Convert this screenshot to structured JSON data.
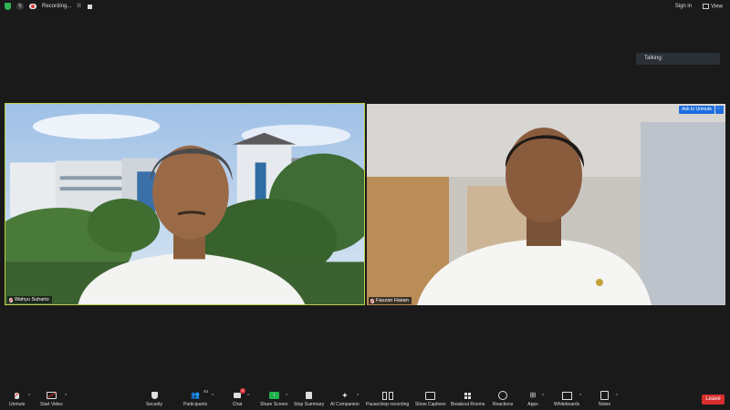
{
  "topbar": {
    "recording_label": "Recording...",
    "pause_glyph": "II",
    "sign_in_label": "Sign in",
    "view_label": "View"
  },
  "talking": {
    "label": "Talking:"
  },
  "participants": [
    {
      "name": "Wahyu Suharto",
      "muted": true,
      "active_speaker": true
    },
    {
      "name": "Fauzan Hasan",
      "muted": true,
      "active_speaker": false
    }
  ],
  "video_actions": {
    "ask_to_unmute": "Ask to Unmute",
    "more_glyph": "···"
  },
  "toolbar": {
    "unmute": "Unmute",
    "start_video": "Start Video",
    "security": "Security",
    "participants": "Participants",
    "participants_count": "44",
    "chat": "Chat",
    "chat_badge": "1",
    "share_screen": "Share Screen",
    "stop_summary": "Stop Summary",
    "ai_companion": "AI Companion",
    "pause_stop_recording": "Pause/stop recording",
    "show_captions": "Show Captions",
    "breakout_rooms": "Breakout Rooms",
    "reactions": "Reactions",
    "apps": "Apps",
    "whiteboards": "Whiteboards",
    "notes": "Notes",
    "leave": "Leave"
  },
  "colors": {
    "background": "#1a1a1a",
    "active_speaker_border": "#b9d24a",
    "recording_red": "#e0383e",
    "share_green": "#22b24c",
    "leave_red": "#d92e2e",
    "action_blue": "#1e6fe0"
  },
  "icons": [
    "shield-icon",
    "mic-off-icon",
    "video-off-icon",
    "security-icon",
    "participants-icon",
    "chat-icon",
    "share-screen-icon",
    "summary-icon",
    "ai-companion-icon",
    "recording-icon",
    "captions-icon",
    "breakout-icon",
    "reactions-icon",
    "apps-icon",
    "whiteboard-icon",
    "notes-icon"
  ]
}
